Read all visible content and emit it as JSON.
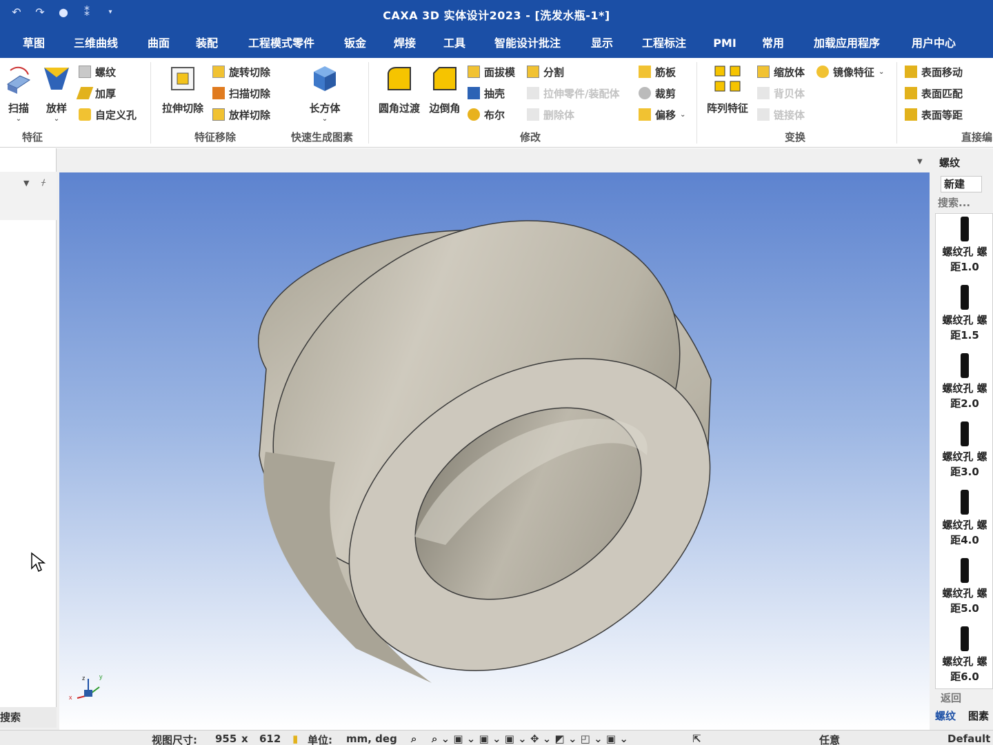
{
  "app": {
    "title": "CAXA 3D 实体设计2023 - [洗发水瓶-1*]"
  },
  "quick_access": [
    "undo-icon",
    "redo-icon",
    "circle-icon",
    "snap-icon",
    "dropdown-icon"
  ],
  "tabs": [
    "草图",
    "三维曲线",
    "曲面",
    "装配",
    "工程模式零件",
    "钣金",
    "焊接",
    "工具",
    "智能设计批注",
    "显示",
    "工程标注",
    "PMI",
    "常用",
    "加载应用程序",
    "用户中心"
  ],
  "ribbon": {
    "feature": {
      "label": "特征",
      "sweep": "扫描",
      "loft": "放样",
      "thread": "螺纹",
      "thicken": "加厚",
      "custom_hole": "自定义孔"
    },
    "feature_remove": {
      "label": "特征移除",
      "extrude_cut": "拉伸切除",
      "revolve_cut": "旋转切除",
      "sweep_cut": "扫描切除",
      "loft_cut": "放样切除"
    },
    "quick_gen": {
      "label": "快速生成图素",
      "box": "长方体"
    },
    "modify": {
      "label": "修改",
      "fillet": "圆角过渡",
      "chamfer": "边倒角",
      "draft": "面拔模",
      "shell": "抽壳",
      "boolean": "布尔",
      "split": "分割",
      "extrude_part": "拉伸零件/装配体",
      "delete_body": "删除体",
      "rib": "筋板",
      "trim": "裁剪",
      "offset": "偏移"
    },
    "transform": {
      "label": "变换",
      "pattern": "阵列特征",
      "scale": "缩放体",
      "mirror": "镜像特征",
      "bezier": "背贝体",
      "link": "链接体"
    },
    "direct": {
      "label": "直接编",
      "face_move": "表面移动",
      "face_match": "表面匹配",
      "face_offset": "表面等距"
    }
  },
  "left_panel": {
    "search": "搜索"
  },
  "right_panel": {
    "title": "螺纹",
    "new_btn": "新建",
    "search_placeholder": "搜索...",
    "items": [
      {
        "l1": "螺纹孔 螺",
        "l2": "距1.0"
      },
      {
        "l1": "螺纹孔 螺",
        "l2": "距1.5"
      },
      {
        "l1": "螺纹孔 螺",
        "l2": "距2.0"
      },
      {
        "l1": "螺纹孔 螺",
        "l2": "距3.0"
      },
      {
        "l1": "螺纹孔 螺",
        "l2": "距4.0"
      },
      {
        "l1": "螺纹孔 螺",
        "l2": "距5.0"
      },
      {
        "l1": "螺纹孔 螺",
        "l2": "距6.0"
      }
    ],
    "back": "返回",
    "bottom_tabs": [
      "螺纹",
      "图素"
    ]
  },
  "status": {
    "view_size_label": "视图尺寸:",
    "w": "955",
    "x": "x",
    "h": "612",
    "unit_label": "单位:",
    "unit_val": "mm, deg",
    "filter": "任意",
    "style": "Default"
  },
  "colors": {
    "accent": "#1b4fa6",
    "part": "#cbc6bd"
  }
}
